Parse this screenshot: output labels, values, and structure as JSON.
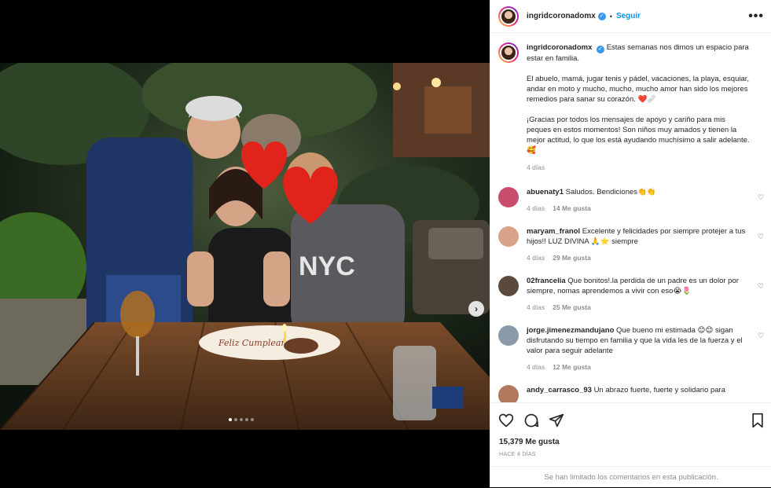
{
  "header": {
    "username": "ingridcoronadomx",
    "follow_label": "Seguir",
    "separator": "•",
    "more_label": "•••"
  },
  "caption": {
    "username": "ingridcoronadomx",
    "paragraph1": "Estas semanas nos dimos un espacio para estar en familia.",
    "paragraph2": "El abuelo, mamá, jugar tenis y pádel, vacaciones, la playa, esquiar, andar en moto y mucho, mucho, mucho amor han sido los mejores remedios para sanar su corazón. ❤️🩹",
    "paragraph3": "¡Gracias por todos los mensajes de apoyo y cariño para mis peques en estos momentos! Son niños muy amados y tienen la mejor actitud, lo que los está ayudando muchísimo a salir adelante. 🥰",
    "time": "4 días"
  },
  "comments": [
    {
      "username": "abuenaty1",
      "text": "Saludos. Bendiciones👏👏",
      "time": "4 días",
      "likes": "14 Me gusta",
      "color": "#c94c6e"
    },
    {
      "username": "maryam_franol",
      "text": "Excelente y felicidades por siempre protejer a tus hijos!! LUZ DIVINA 🙏⭐ siempre",
      "time": "4 días",
      "likes": "29 Me gusta",
      "color": "#d9a38a"
    },
    {
      "username": "02francelia",
      "text": "Que bonitos!.la perdida de un padre es un dolor por siempre, nomas aprendemos a vivir con eso😭🌷",
      "time": "4 días",
      "likes": "25 Me gusta",
      "color": "#5a4a3c"
    },
    {
      "username": "jorge.jimenezmandujano",
      "text": "Que bueno mi estimada 😊😊 sigan disfrutando su tiempo en familia y que la vida les de la fuerza y el valor para seguir adelante",
      "time": "4 días",
      "likes": "12 Me gusta",
      "color": "#8a9aa8"
    },
    {
      "username": "andy_carrasco_93",
      "text": "Un abrazo fuerte, fuerte y solidario para",
      "time": "",
      "likes": "",
      "color": "#b0785c"
    }
  ],
  "footer": {
    "likes": "15,379 Me gusta",
    "time_ago": "HACE 4 DÍAS",
    "limited": "Se han limitado los comentarios en esta publicación."
  },
  "photo": {
    "cake_plate_text": "Feliz Cumpleaños",
    "shirt_text": "NYC",
    "carousel_next": "›",
    "slide_count": 5,
    "active_slide": 1
  },
  "colors": {
    "accent": "#0095f6",
    "heart": "#e0241c",
    "meta": "#8e8e8e"
  }
}
